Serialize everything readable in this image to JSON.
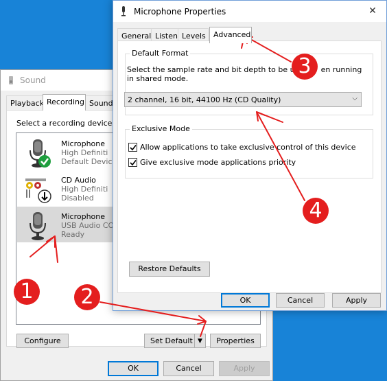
{
  "sound": {
    "title": "Sound",
    "tabs": [
      "Playback",
      "Recording",
      "Sounds"
    ],
    "description": "Select a recording device be",
    "devices": [
      {
        "name": "Microphone",
        "line2": "High Definiti",
        "line3": "Default Device"
      },
      {
        "name": "CD Audio",
        "line2": "High Definiti",
        "line3": "Disabled"
      },
      {
        "name": "Microphone",
        "line2": "USB Audio COD",
        "line3": "Ready"
      }
    ],
    "configure_label": "Configure",
    "set_default_label": "Set Default",
    "properties_label": "Properties",
    "ok_label": "OK",
    "cancel_label": "Cancel",
    "apply_label": "Apply"
  },
  "mic": {
    "title": "Microphone Properties",
    "close_glyph": "✕",
    "tabs": [
      "General",
      "Listen",
      "Levels",
      "Advanced"
    ],
    "default_format": {
      "label": "Default Format",
      "desc1": "Select the sample rate and bit depth to be u",
      "desc1b": "en running",
      "desc2": "in shared mode.",
      "selected": "2 channel, 16 bit, 44100 Hz (CD Quality)"
    },
    "exclusive": {
      "label": "Exclusive Mode",
      "opt1": "Allow applications to take exclusive control of this device",
      "opt2": "Give exclusive mode applications priority"
    },
    "restore_label": "Restore Defaults",
    "ok_label": "OK",
    "cancel_label": "Cancel",
    "apply_label": "Apply"
  },
  "annotations": {
    "n1": "1",
    "n2": "2",
    "n3": "3",
    "n4": "4",
    "color": "#e41e1e"
  }
}
